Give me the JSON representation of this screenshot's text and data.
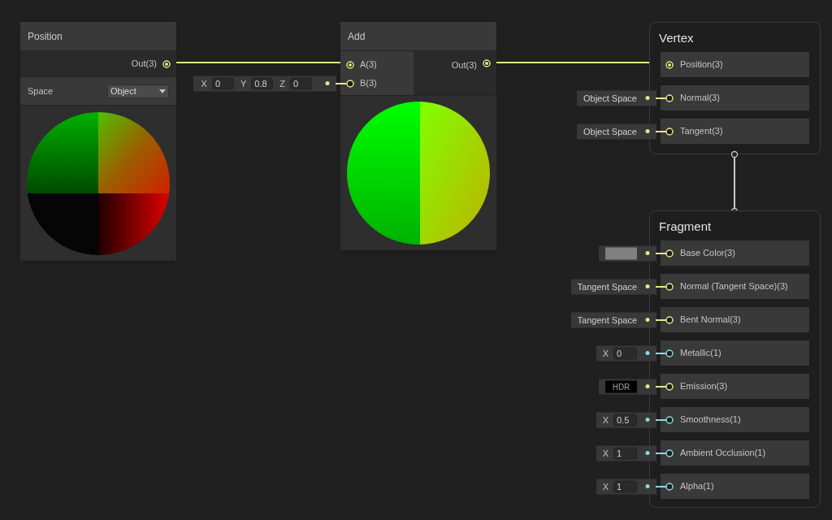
{
  "position_node": {
    "title": "Position",
    "output": {
      "label": "Out(3)",
      "kind": "vector",
      "connected": true
    },
    "space": {
      "label": "Space",
      "value": "Object"
    }
  },
  "add_node": {
    "title": "Add",
    "inputs": [
      {
        "label": "A(3)",
        "kind": "vector",
        "connected": true
      },
      {
        "label": "B(3)",
        "kind": "vector",
        "connected": false,
        "control": {
          "kind": "vector",
          "fields": [
            {
              "axis": "X",
              "value": "0"
            },
            {
              "axis": "Y",
              "value": "0.8"
            },
            {
              "axis": "Z",
              "value": "0"
            }
          ]
        }
      }
    ],
    "output": {
      "label": "Out(3)",
      "kind": "vector",
      "connected": true
    }
  },
  "vertex": {
    "title": "Vertex",
    "slots": [
      {
        "label": "Position(3)",
        "kind": "vector",
        "connected": true
      },
      {
        "label": "Normal(3)",
        "kind": "vector",
        "connected": false,
        "control": {
          "kind": "text",
          "text": "Object Space"
        }
      },
      {
        "label": "Tangent(3)",
        "kind": "vector",
        "connected": false,
        "control": {
          "kind": "text",
          "text": "Object Space"
        }
      }
    ]
  },
  "fragment": {
    "title": "Fragment",
    "slots": [
      {
        "label": "Base Color(3)",
        "kind": "vector",
        "connected": false,
        "control": {
          "kind": "color",
          "color": "#808080"
        }
      },
      {
        "label": "Normal (Tangent Space)(3)",
        "kind": "vector",
        "connected": false,
        "control": {
          "kind": "text",
          "text": "Tangent Space"
        }
      },
      {
        "label": "Bent Normal(3)",
        "kind": "vector",
        "connected": false,
        "control": {
          "kind": "text",
          "text": "Tangent Space"
        }
      },
      {
        "label": "Metallic(1)",
        "kind": "float",
        "connected": false,
        "control": {
          "kind": "float",
          "axis": "X",
          "value": "0"
        }
      },
      {
        "label": "Emission(3)",
        "kind": "vector",
        "connected": false,
        "control": {
          "kind": "hdr",
          "text": "HDR"
        }
      },
      {
        "label": "Smoothness(1)",
        "kind": "float",
        "connected": false,
        "control": {
          "kind": "float",
          "axis": "X",
          "value": "0.5"
        }
      },
      {
        "label": "Ambient Occlusion(1)",
        "kind": "float",
        "connected": false,
        "control": {
          "kind": "float",
          "axis": "X",
          "value": "1"
        }
      },
      {
        "label": "Alpha(1)",
        "kind": "float",
        "connected": false,
        "control": {
          "kind": "float",
          "axis": "X",
          "value": "1"
        }
      }
    ]
  }
}
